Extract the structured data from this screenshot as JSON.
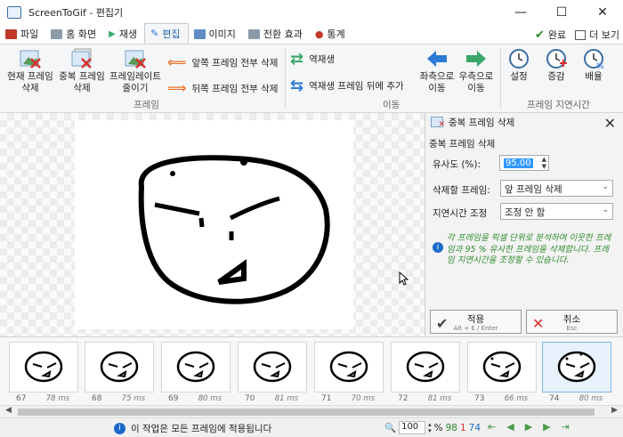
{
  "window": {
    "title": "ScreenToGif - 편집기",
    "controls": {
      "minimize": "—",
      "maximize": "☐",
      "close": "✕"
    }
  },
  "tabs": [
    {
      "label": "파일",
      "icon": "file-icon",
      "color": "#c0392b"
    },
    {
      "label": "홈 화면",
      "icon": "home-icon",
      "color": "#7f8c8d"
    },
    {
      "label": "재생",
      "icon": "play-icon",
      "color": "#3aa66a"
    },
    {
      "label": "편집",
      "icon": "edit-icon",
      "color": "#2c7bd6",
      "active": true
    },
    {
      "label": "이미지",
      "icon": "image-icon",
      "color": "#5d8bc4"
    },
    {
      "label": "전환 효과",
      "icon": "transition-icon",
      "color": "#7f8c8d"
    },
    {
      "label": "통계",
      "icon": "stats-icon",
      "color": "#c0392b"
    }
  ],
  "tab_right": {
    "done": "완료",
    "more": "더 보기"
  },
  "ribbon": {
    "frame_group": {
      "label": "프레임",
      "delete_current": "현재 프레임\n삭제",
      "delete_duplicates": "중복 프레임\n삭제",
      "reduce_framerate": "프레임레이트\n줄이기",
      "delete_previous": "앞쪽 프레임 전부 삭제",
      "delete_next": "뒤쪽 프레임 전부 삭제"
    },
    "move_group": {
      "label": "이동",
      "reverse": "역재생",
      "yoyo": "역재생 프레임 뒤에 추가",
      "move_left": "좌측으로\n이동",
      "move_right": "우측으로\n이동"
    },
    "delay_group": {
      "label": "프레임 지연시간",
      "set": "설정",
      "increase": "증감",
      "scale": "배율"
    }
  },
  "panel": {
    "header": "중복 프레임 삭제",
    "subtitle": "중복 프레임 삭제",
    "similarity_label": "유사도 (%):",
    "similarity_value": "95.00",
    "delete_label": "삭제할 프레임:",
    "delete_value": "앞 프레임 삭제",
    "delay_label": "지연시간 조정",
    "delay_value": "조정 안 함",
    "info": "각 프레임을 픽셀 단위로 분석하여 이웃한 프레임과 95 % 유사한 프레임을 삭제합니다. 프레임 지연시간을 조정할 수 있습니다.",
    "apply_label": "적용",
    "apply_key": "Alt + E / Enter",
    "cancel_label": "취소",
    "cancel_key": "Esc"
  },
  "frames": [
    {
      "num": "67",
      "ms": "78 ms"
    },
    {
      "num": "68",
      "ms": "75 ms"
    },
    {
      "num": "69",
      "ms": "80 ms"
    },
    {
      "num": "70",
      "ms": "81 ms"
    },
    {
      "num": "71",
      "ms": "70 ms"
    },
    {
      "num": "72",
      "ms": "81 ms"
    },
    {
      "num": "73",
      "ms": "66 ms"
    },
    {
      "num": "74",
      "ms": "80 ms",
      "selected": true
    }
  ],
  "status": {
    "message": "이 작업은 모든 프레임에 적용됩니다",
    "zoom": "100",
    "zoom_unit": "%",
    "total": "98",
    "selected": "1",
    "current": "74"
  },
  "colors": {
    "accent": "#1b6ac9",
    "green": "#2e8b2e",
    "selection": "#3399ff"
  }
}
